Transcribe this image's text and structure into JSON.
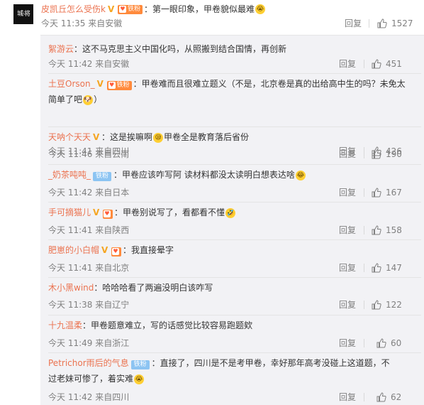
{
  "main_comment": {
    "avatar_text": "城·将",
    "user": "皮凯丘怎么受伤k",
    "fan_badge": "铁粉",
    "text": "：第一眼印象，甲卷貌似最难",
    "time": "今天 11:35 来自安徽",
    "reply_label": "回复",
    "likes": "1527"
  },
  "replies": [
    {
      "user": "絮游云",
      "text": "：这不马克思主义中国化吗，从照搬到结合国情，再创新",
      "time": "今天 11:42 来自安徽",
      "reply_label": "回复",
      "likes": "451",
      "vip": false,
      "fan": "",
      "fan_style": "",
      "emoji_before": "",
      "emoji_after": ""
    },
    {
      "user": "土豆Orson_",
      "text": "：甲卷难而且很难立题义（不是，北京卷是真的出给高中生的吗？未免太简单了吧",
      "text_end": "）",
      "time": "今天 11:41 来自四川",
      "reply_label": "回复",
      "likes": "426",
      "vip": true,
      "fan": "铁粉",
      "fan_style": "orange"
    },
    {
      "user": "天呐个天天",
      "text": "：这是挨嘛啊",
      "text_end": "甲卷全是教育落后省份",
      "time": "今天 11:46 来自云南",
      "reply_label": "回复",
      "likes": "190",
      "vip": true,
      "fan": "",
      "fan_style": ""
    },
    {
      "user": "_奶茶吨吨_",
      "text": "：甲卷应该咋写阿 读材料都没太读明白想表达啥",
      "time": "今天 11:42 来自日本",
      "reply_label": "回复",
      "likes": "167",
      "vip": false,
      "fan": "铁粉",
      "fan_style": "blue"
    },
    {
      "user": "手可摘猫儿",
      "text": "：甲卷别说写了，看都看不懂",
      "time": "今天 11:41 来自陕西",
      "reply_label": "回复",
      "likes": "158",
      "vip": true,
      "fan": "",
      "fan_style": "orange"
    },
    {
      "user": "肥崽的小白帽",
      "text": "：我直接晕字",
      "time": "今天 11:41 来自北京",
      "reply_label": "回复",
      "likes": "147",
      "vip": true,
      "fan": "",
      "fan_style": "orange"
    },
    {
      "user": "木小黑wind",
      "text": "：哈哈哈看了两遍没明白该咋写",
      "time": "今天 11:38 来自辽宁",
      "reply_label": "回复",
      "likes": "122",
      "vip": false,
      "fan": "",
      "fan_style": ""
    },
    {
      "user": "十九温柔",
      "text": "：甲卷题意难立，写的话感觉比较容易跑题欸",
      "time": "今天 11:49 来自浙江",
      "reply_label": "回复",
      "likes": "60",
      "vip": false,
      "fan": "",
      "fan_style": ""
    },
    {
      "user": "Petrichor雨后的气息",
      "text": "：直接了，四川是不是考甲卷，幸好那年高考没碰上这道题，不过老妹可惨了，着实难",
      "time": "今天 11:42 来自四川",
      "reply_label": "回复",
      "likes": "62",
      "vip": false,
      "fan": "铁粉",
      "fan_style": "blue"
    }
  ]
}
